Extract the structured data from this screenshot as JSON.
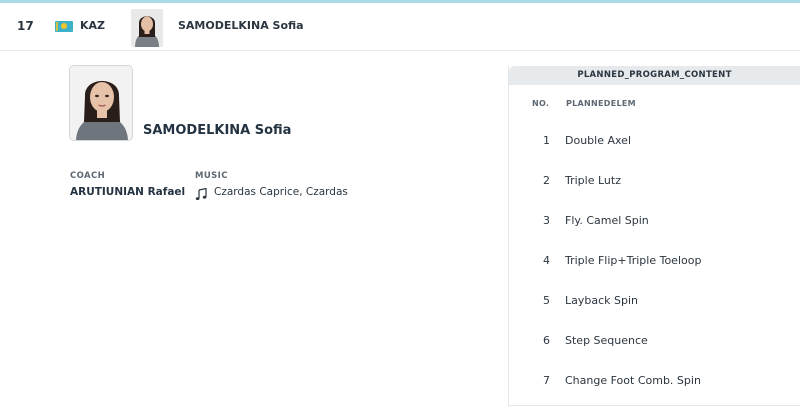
{
  "header": {
    "rank": "17",
    "flag_icon": "kazakhstan-flag-icon",
    "nation": "KAZ",
    "skater_name": "SAMODELKINA Sofia"
  },
  "profile": {
    "name": "SAMODELKINA Sofia",
    "coach_label": "COACH",
    "coach": "ARUTIUNIAN Rafael",
    "music_label": "MUSIC",
    "music_icon": "music-note-icon",
    "music": "Czardas Caprice, Czardas"
  },
  "program": {
    "title": "PLANNED_PROGRAM_CONTENT",
    "col_no": "NO.",
    "col_elem": "PLANNEDELEM",
    "elements": [
      {
        "no": "1",
        "name": "Double Axel"
      },
      {
        "no": "2",
        "name": "Triple Lutz"
      },
      {
        "no": "3",
        "name": "Fly. Camel Spin"
      },
      {
        "no": "4",
        "name": "Triple Flip+Triple Toeloop"
      },
      {
        "no": "5",
        "name": "Layback Spin"
      },
      {
        "no": "6",
        "name": "Step Sequence"
      },
      {
        "no": "7",
        "name": "Change Foot Comb. Spin"
      }
    ]
  },
  "colors": {
    "accent": "#a9dbe4",
    "table_header_bg": "#e7eaec",
    "text": "#2b3640",
    "flag_blue": "#3cb1c8",
    "flag_gold": "#f4c430"
  }
}
